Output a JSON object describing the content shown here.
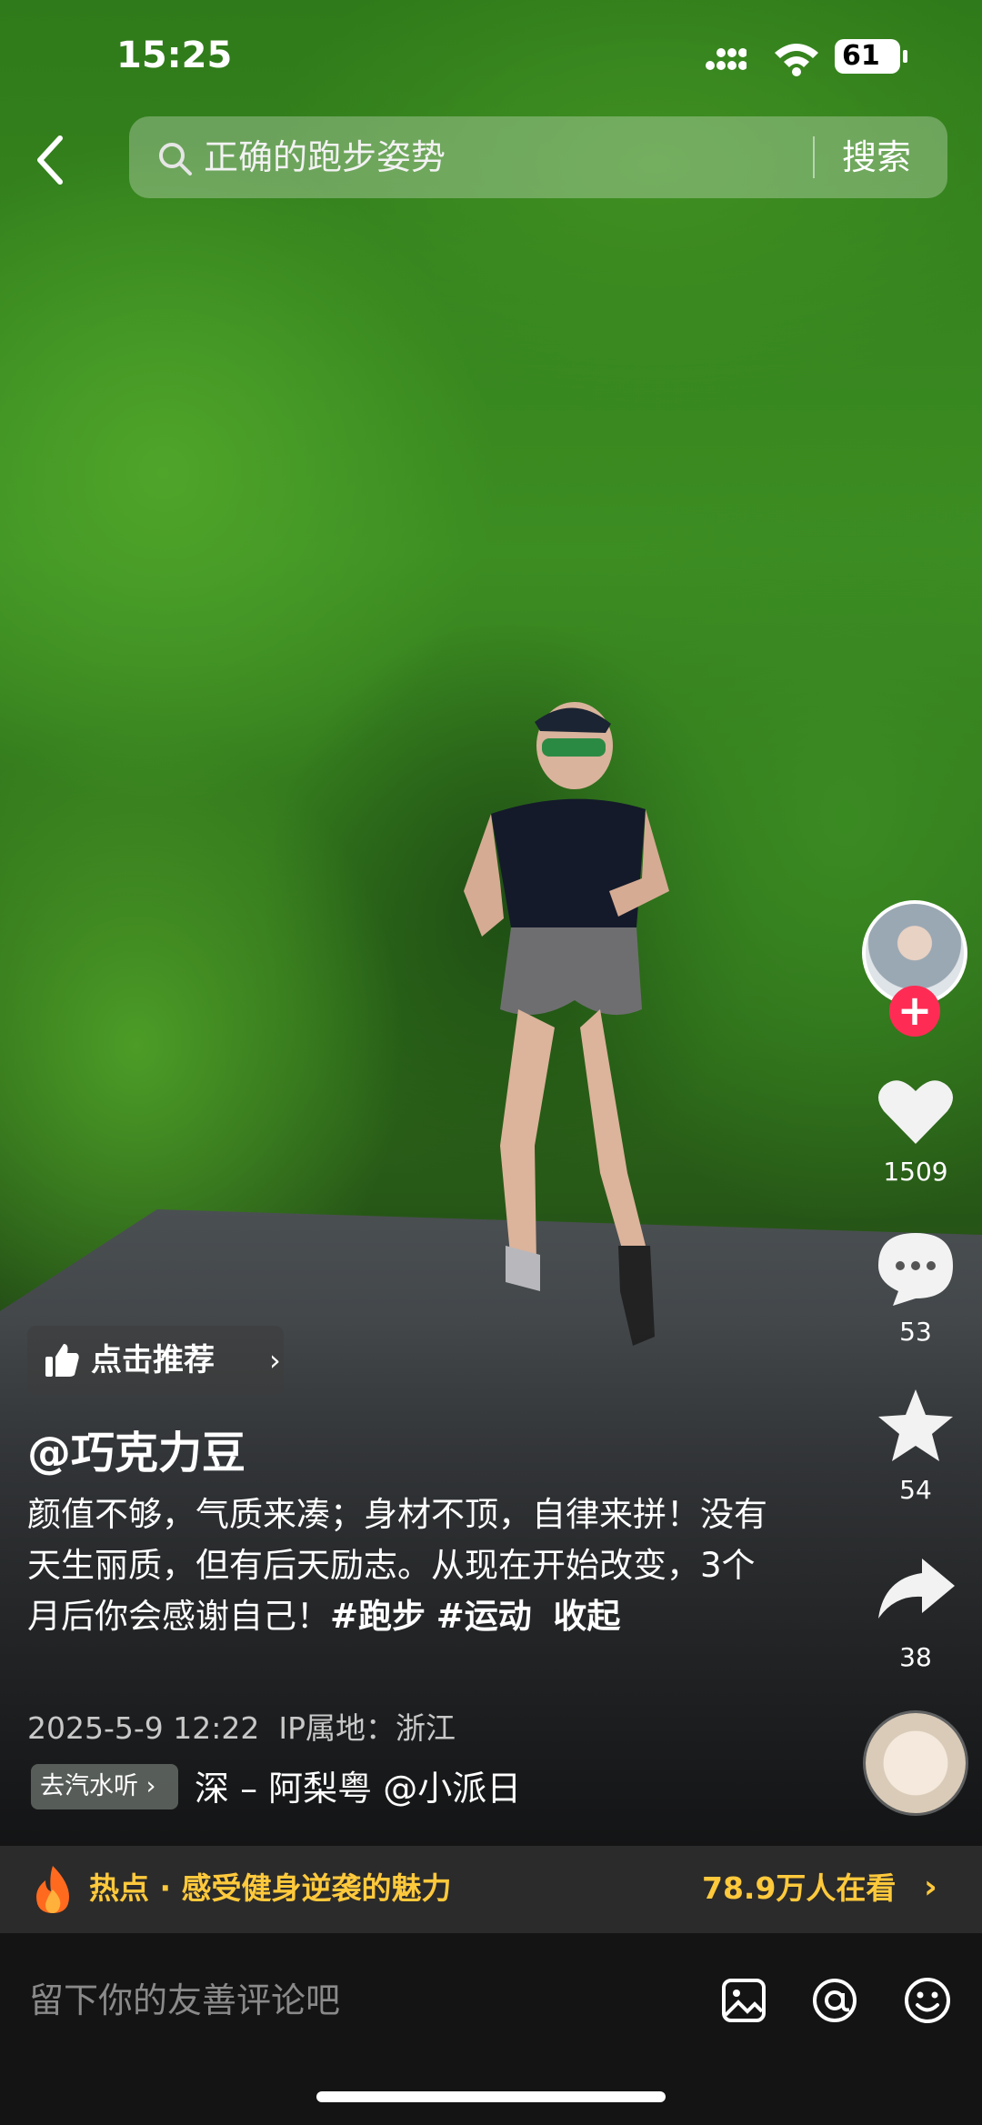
{
  "status_bar": {
    "time": "15:25",
    "battery": "61"
  },
  "search": {
    "query": "正确的跑步姿势",
    "button": "搜索"
  },
  "rail": {
    "likes": "1509",
    "comments": "53",
    "favorites": "54",
    "shares": "38",
    "follow_symbol": "+"
  },
  "recommend": {
    "label": "点击推荐",
    "chevron": "›"
  },
  "post": {
    "author": "@巧克力豆",
    "desc_plain": "颜值不够，气质来凑；身材不顶，自律来拼！没有天生丽质，但有后天励志。从现在开始改变，3个月后你会感谢自己！",
    "tag1": "#跑步",
    "tag2": "#运动",
    "collapse": "收起",
    "date": "2025-5-9 12:22",
    "ip": "IP属地：浙江"
  },
  "music": {
    "tag": "去汽水听 ›",
    "text": "深 – 阿梨粤   @小派日"
  },
  "hot": {
    "text": "热点 · 感受健身逆袭的魅力",
    "count": "78.9万人在看",
    "chevron": "›"
  },
  "comment": {
    "placeholder": "留下你的友善评论吧"
  },
  "colors": {
    "accent_red": "#fe2c55",
    "hot_yellow": "#ffc93c"
  }
}
